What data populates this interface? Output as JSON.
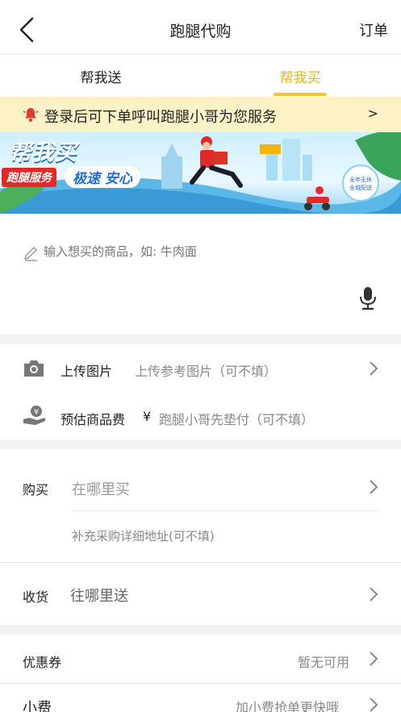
{
  "header": {
    "title": "跑腿代购",
    "orders_label": "订单"
  },
  "tabs": [
    {
      "label": "帮我送",
      "active": false
    },
    {
      "label": "帮我买",
      "active": true
    }
  ],
  "notice": {
    "text": "登录后可下单呼叫跑腿小哥为您服务",
    "arrow": ">"
  },
  "banner": {
    "title": "帮我买",
    "tag_service": "跑腿服务",
    "tag_speed": "极速 安心",
    "badge_line1": "全年无休",
    "badge_line2": "全城配送"
  },
  "item_input": {
    "placeholder": "输入想买的商品，如: 牛肉面"
  },
  "upload": {
    "label": "上传图片",
    "hint": "上传参考图片（可不填）"
  },
  "estimate": {
    "label": "预估商品费",
    "currency": "¥",
    "hint": "跑腿小哥先垫付（可不填）"
  },
  "buy": {
    "label": "购买",
    "placeholder": "在哪里买",
    "detail_hint": "补充采购详细地址(可不填)"
  },
  "receive": {
    "label": "收货",
    "placeholder": "往哪里送"
  },
  "coupon": {
    "label": "优惠券",
    "value": "暂无可用"
  },
  "tip": {
    "label": "小费",
    "value": "加小费抢单更快哦"
  },
  "colors": {
    "accent": "#f7c325",
    "accent_text": "#f2b705",
    "notice_bg": "#fdf2c7",
    "bell": "#e33b2f"
  }
}
